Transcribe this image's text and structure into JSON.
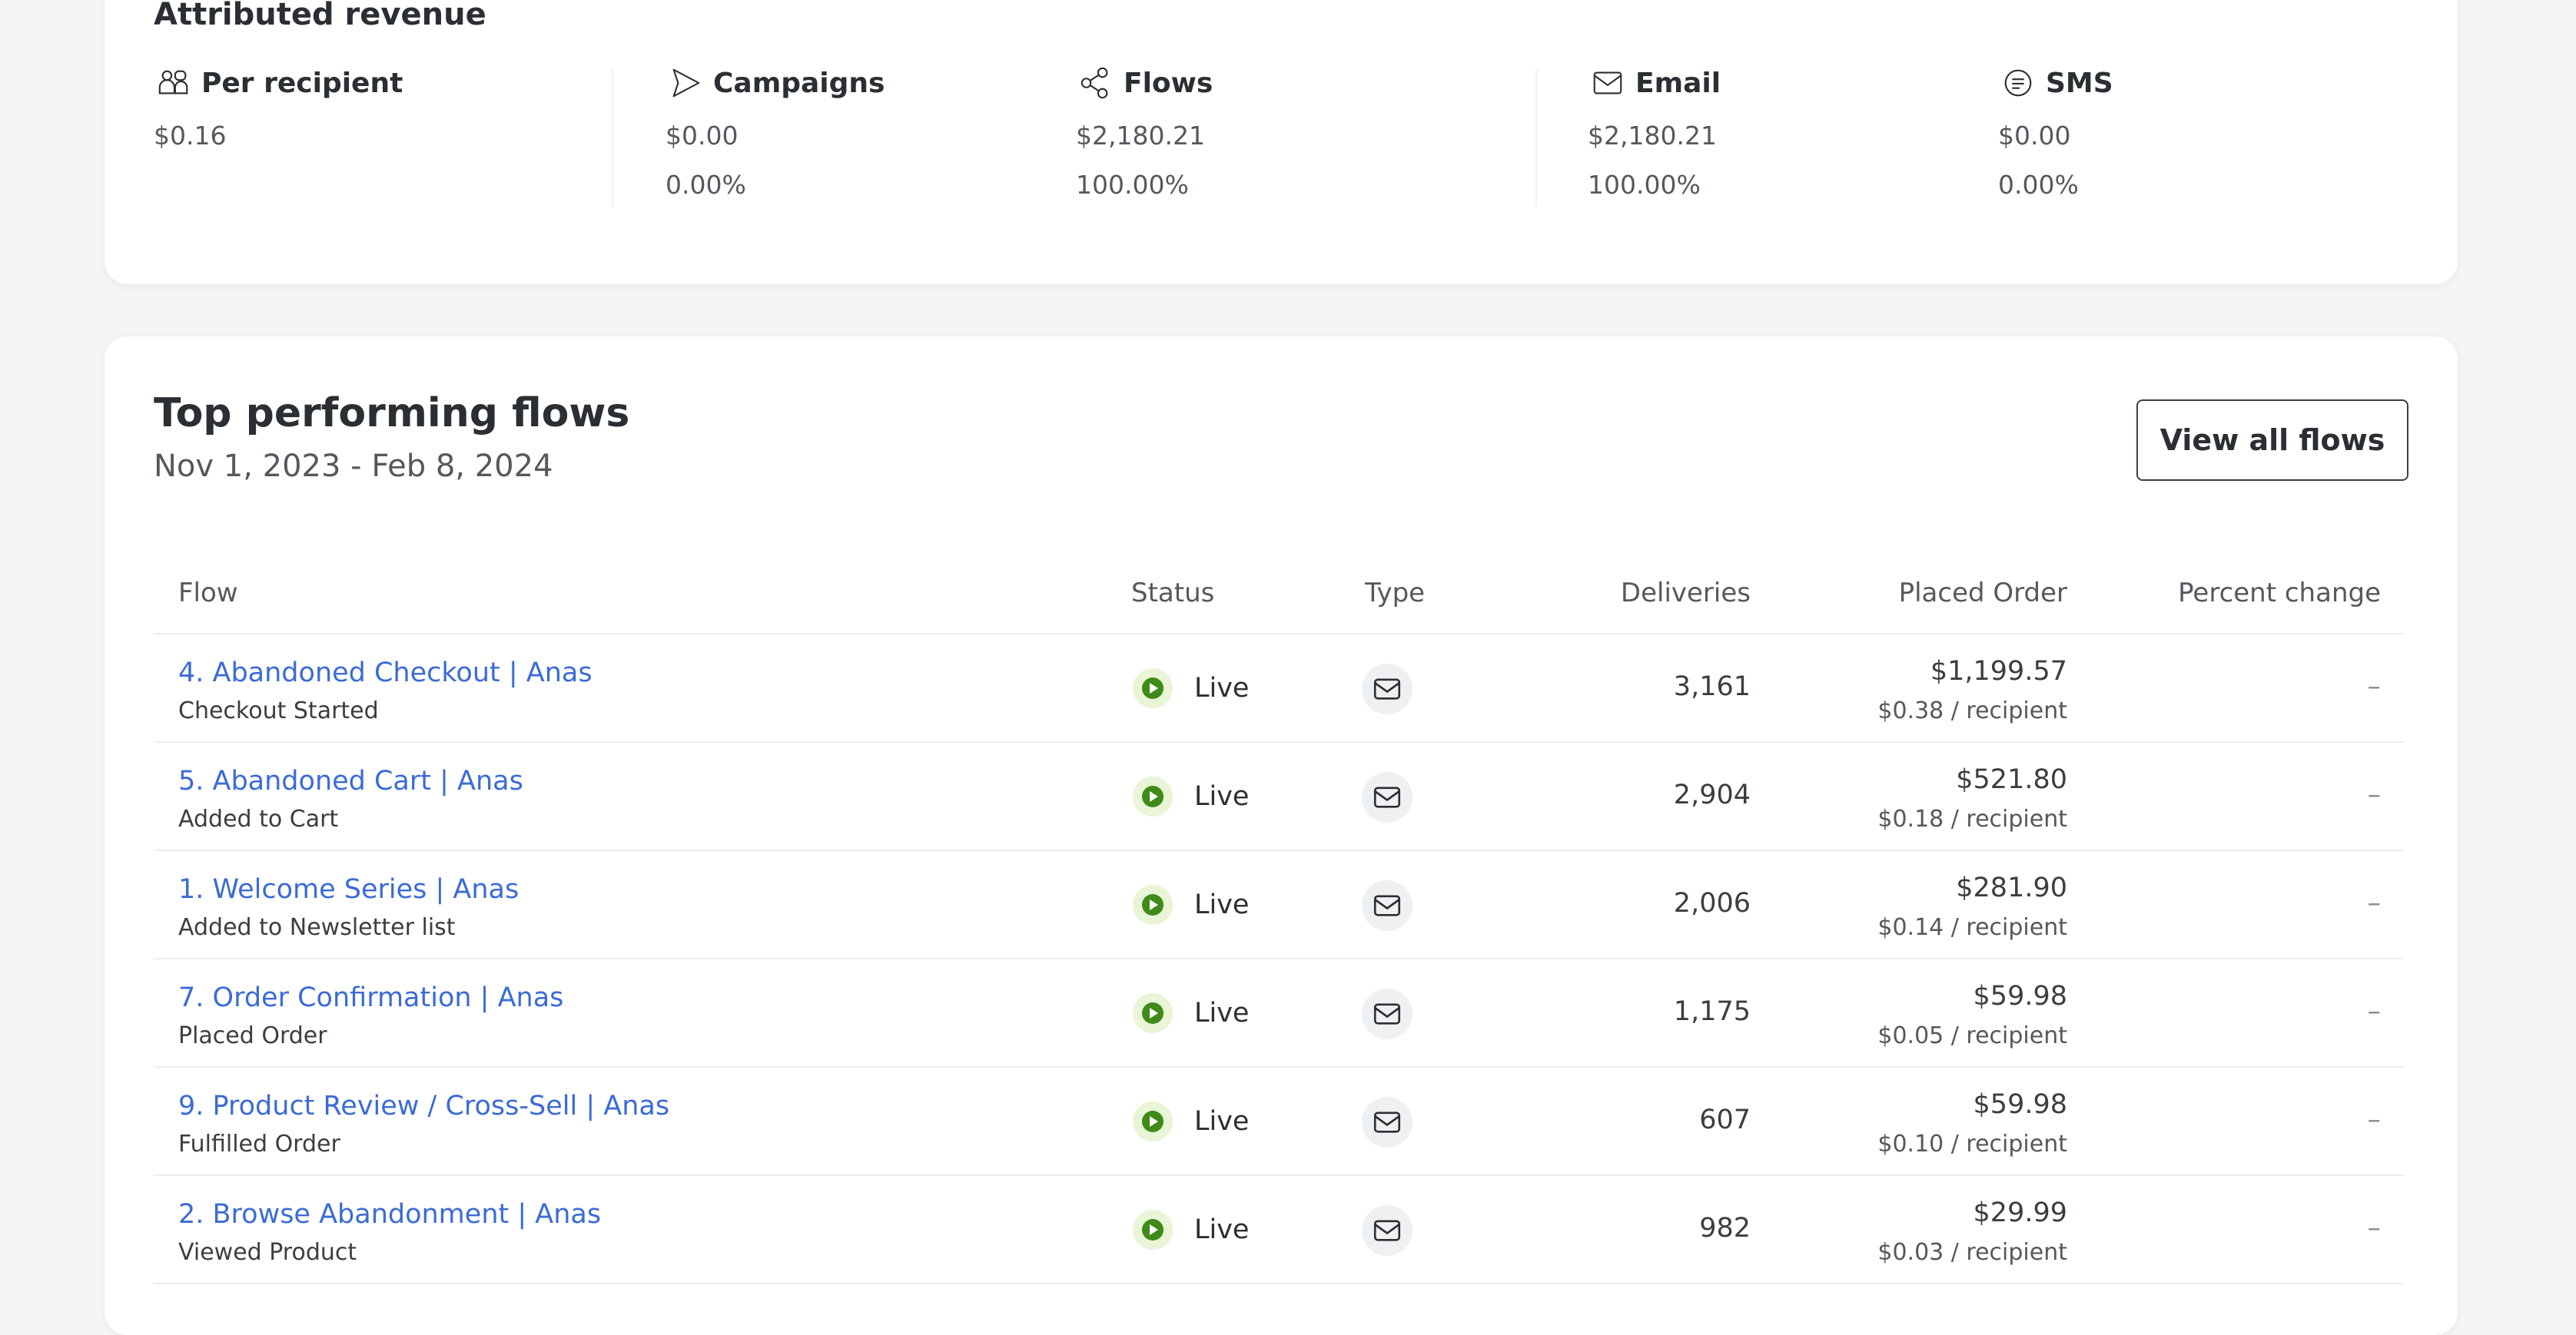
{
  "revenue": {
    "title": "Attributed revenue",
    "metrics": [
      {
        "label": "Per recipient",
        "icon": "people-icon",
        "value": "$0.16",
        "pct": ""
      },
      {
        "label": "Campaigns",
        "icon": "send-icon",
        "value": "$0.00",
        "pct": "0.00%"
      },
      {
        "label": "Flows",
        "icon": "flow-icon",
        "value": "$2,180.21",
        "pct": "100.00%"
      },
      {
        "label": "Email",
        "icon": "mail-icon",
        "value": "$2,180.21",
        "pct": "100.00%"
      },
      {
        "label": "SMS",
        "icon": "chat-icon",
        "value": "$0.00",
        "pct": "0.00%"
      }
    ]
  },
  "flows": {
    "title": "Top performing flows",
    "date_range": "Nov 1, 2023 - Feb 8, 2024",
    "view_all_label": "View all flows",
    "columns": {
      "flow": "Flow",
      "status": "Status",
      "type": "Type",
      "deliveries": "Deliveries",
      "placed_order": "Placed Order",
      "percent_change": "Percent change"
    },
    "rows": [
      {
        "name": "4. Abandoned Checkout | Anas",
        "trigger": "Checkout Started",
        "status": "Live",
        "type": "email",
        "deliveries": "3,161",
        "placed_order": "$1,199.57",
        "per_recipient": "$0.38 / recipient",
        "percent_change": "–"
      },
      {
        "name": "5. Abandoned Cart | Anas",
        "trigger": "Added to Cart",
        "status": "Live",
        "type": "email",
        "deliveries": "2,904",
        "placed_order": "$521.80",
        "per_recipient": "$0.18 / recipient",
        "percent_change": "–"
      },
      {
        "name": "1. Welcome Series | Anas",
        "trigger": "Added to Newsletter list",
        "status": "Live",
        "type": "email",
        "deliveries": "2,006",
        "placed_order": "$281.90",
        "per_recipient": "$0.14 / recipient",
        "percent_change": "–"
      },
      {
        "name": "7. Order Confirmation | Anas",
        "trigger": "Placed Order",
        "status": "Live",
        "type": "email",
        "deliveries": "1,175",
        "placed_order": "$59.98",
        "per_recipient": "$0.05 / recipient",
        "percent_change": "–"
      },
      {
        "name": "9. Product Review / Cross-Sell | Anas",
        "trigger": "Fulfilled Order",
        "status": "Live",
        "type": "email",
        "deliveries": "607",
        "placed_order": "$59.98",
        "per_recipient": "$0.10 / recipient",
        "percent_change": "–"
      },
      {
        "name": "2. Browse Abandonment | Anas",
        "trigger": "Viewed Product",
        "status": "Live",
        "type": "email",
        "deliveries": "982",
        "placed_order": "$29.99",
        "per_recipient": "$0.03 / recipient",
        "percent_change": "–"
      }
    ]
  },
  "colors": {
    "link": "#3b6bd6",
    "live": "#3f8a18",
    "live_bg": "#e8f5d6"
  }
}
